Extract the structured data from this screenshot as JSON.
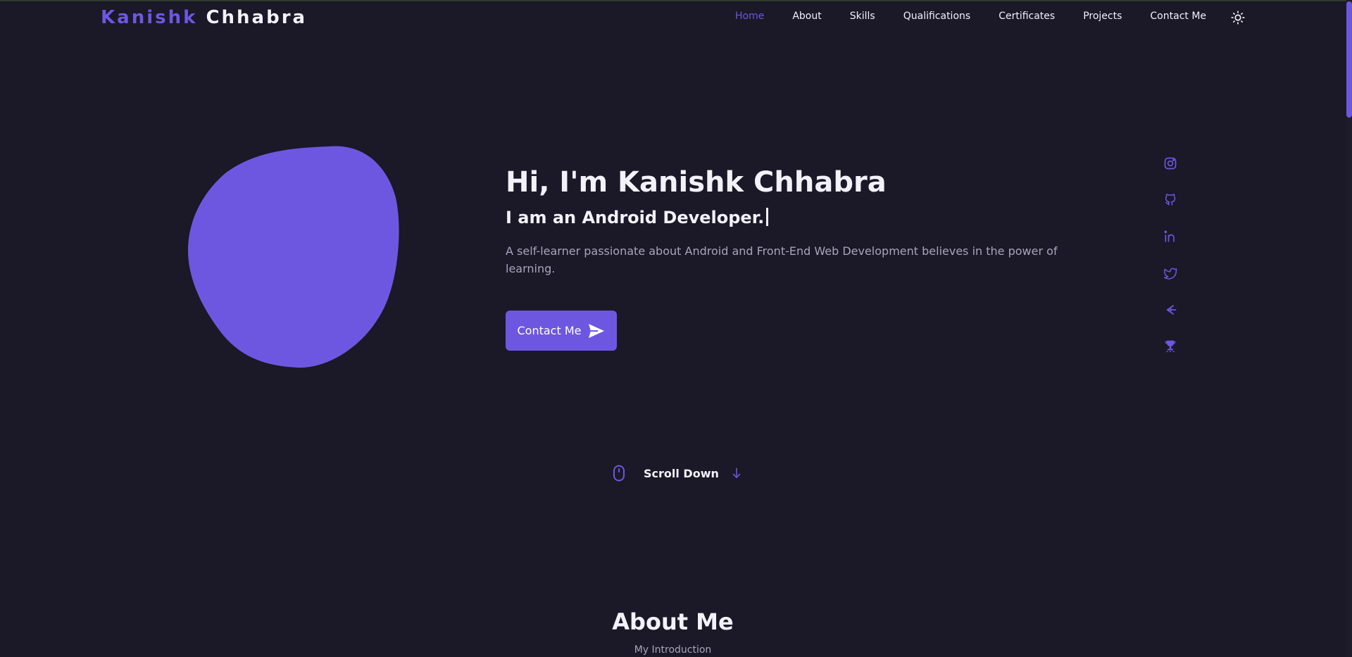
{
  "colors": {
    "accent": "#6e57e0",
    "background": "#1b1827",
    "title": "#f3f1f9",
    "text": "#a9a5bb"
  },
  "header": {
    "logo_first": "Kanishk",
    "logo_last": "Chhabra",
    "nav": [
      {
        "label": "Home",
        "active": true
      },
      {
        "label": "About"
      },
      {
        "label": "Skills"
      },
      {
        "label": "Qualifications"
      },
      {
        "label": "Certificates"
      },
      {
        "label": "Projects"
      },
      {
        "label": "Contact Me"
      }
    ],
    "theme_icon": "sun-icon"
  },
  "hero": {
    "title": "Hi, I'm Kanishk Chhabra",
    "subtitle": "I am an Android Developer.",
    "description": "A self-learner passionate about Android and Front-End Web Development believes in the power of learning.",
    "cta_label": "Contact Me",
    "cta_icon": "send-icon"
  },
  "social": [
    "instagram-icon",
    "github-icon",
    "linkedin-icon",
    "twitter-icon",
    "gfg-icon",
    "trophy-icon"
  ],
  "scroll_down": {
    "label": "Scroll Down",
    "icon": "mouse-icon",
    "arrow": "arrow-down-icon"
  },
  "about": {
    "title": "About Me",
    "subtitle": "My Introduction"
  }
}
